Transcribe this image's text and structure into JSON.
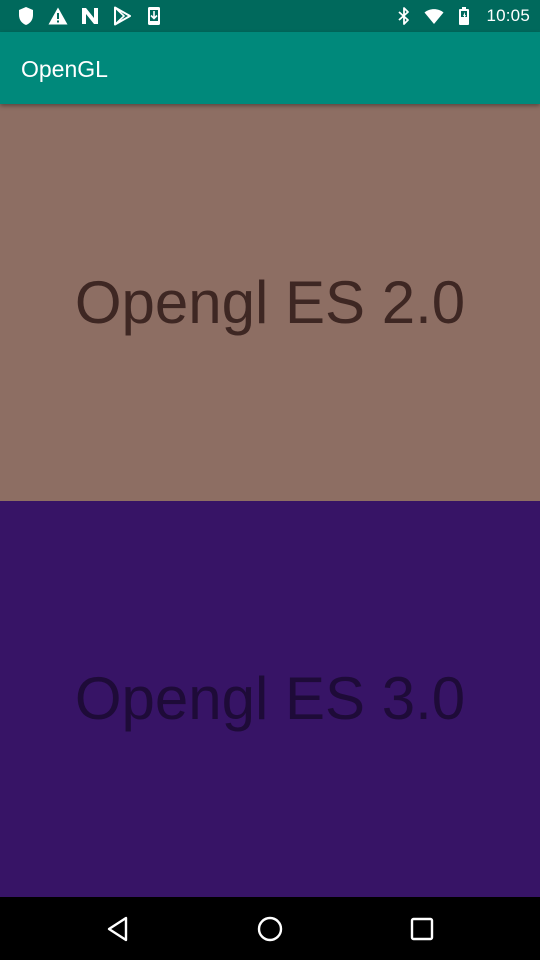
{
  "status_bar": {
    "time": "10:05",
    "left_icons": [
      "shield-icon",
      "warning-icon",
      "n-icon",
      "play-store-icon",
      "download-icon"
    ],
    "right_icons": [
      "bluetooth-icon",
      "wifi-icon",
      "battery-icon"
    ],
    "color": "#00695c"
  },
  "app_bar": {
    "title": "OpenGL",
    "color": "#00897b"
  },
  "panels": [
    {
      "label": "Opengl ES 2.0",
      "color": "#8d6e63"
    },
    {
      "label": "Opengl ES 3.0",
      "color": "#371466"
    }
  ],
  "nav_bar": {
    "buttons": [
      "back-icon",
      "home-icon",
      "recents-icon"
    ]
  }
}
